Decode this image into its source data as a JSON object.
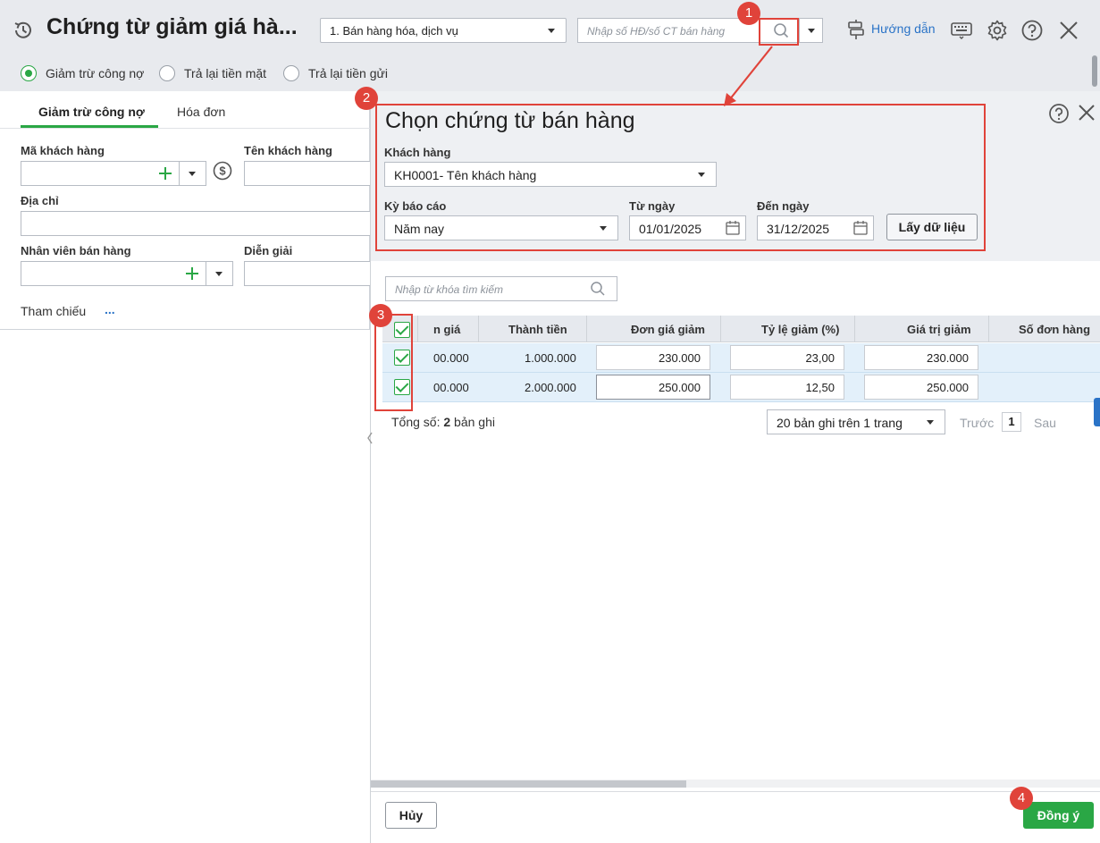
{
  "header": {
    "title": "Chứng từ giảm giá hà...",
    "doc_type": "1. Bán hàng hóa, dịch vụ",
    "search_placeholder": "Nhập số HĐ/số CT bán hàng",
    "guide_label": "Hướng dẫn"
  },
  "payment_options": [
    {
      "label": "Giảm trừ công nợ",
      "selected": true
    },
    {
      "label": "Trả lại tiền mặt",
      "selected": false
    },
    {
      "label": "Trả lại tiền gửi",
      "selected": false
    }
  ],
  "tabs": [
    "Giảm trừ công nợ",
    "Hóa đơn"
  ],
  "form": {
    "customer_code_label": "Mã khách hàng",
    "customer_name_label": "Tên khách hàng",
    "address_label": "Địa chỉ",
    "salesperson_label": "Nhân viên bán hàng",
    "description_label": "Diễn giải",
    "reference_label": "Tham chiếu",
    "reference_more": "..."
  },
  "dialog": {
    "title": "Chọn chứng từ bán hàng",
    "customer_label": "Khách hàng",
    "customer_value": "KH0001- Tên khách hàng",
    "period_label": "Kỳ báo cáo",
    "period_value": "Năm nay",
    "from_label": "Từ ngày",
    "from_value": "01/01/2025",
    "to_label": "Đến ngày",
    "to_value": "31/12/2025",
    "fetch_label": "Lấy dữ liệu",
    "grid_search_placeholder": "Nhập từ khóa tìm kiếm",
    "columns": [
      "n giá",
      "Thành tiền",
      "Đơn giá giảm",
      "Tỷ lệ giảm (%)",
      "Giá trị giảm",
      "Số đơn hàng"
    ],
    "rows": [
      {
        "unit_price": "00.000",
        "amount": "1.000.000",
        "discount_price": "230.000",
        "discount_rate": "23,00",
        "discount_value": "230.000",
        "order_no": ""
      },
      {
        "unit_price": "00.000",
        "amount": "2.000.000",
        "discount_price": "250.000",
        "discount_rate": "12,50",
        "discount_value": "250.000",
        "order_no": ""
      }
    ],
    "total_prefix": "Tổng số: ",
    "total_count": "2",
    "total_suffix": " bản ghi",
    "page_size": "20 bản ghi trên 1 trang",
    "prev_label": "Trước",
    "page_number": "1",
    "next_label": "Sau",
    "cancel_label": "Hủy",
    "ok_label": "Đồng ý"
  },
  "annotations": [
    "1",
    "2",
    "3",
    "4"
  ],
  "colors": {
    "accent_green": "#2aa745",
    "annotation_red": "#e0433a",
    "link_blue": "#2a73c7",
    "row_highlight": "#e3f0fa"
  }
}
